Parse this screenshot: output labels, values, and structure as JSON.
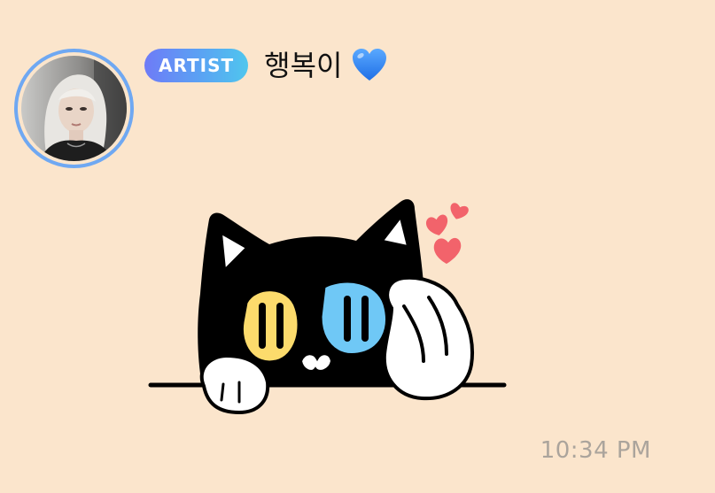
{
  "message": {
    "role_badge": "ARTIST",
    "sender_name": "행복이",
    "name_emoji_icon": "blue-heart-icon",
    "sticker_icon": "black-cat-peeking-sticker",
    "timestamp": "10:34 PM"
  },
  "colors": {
    "background": "#FBE5CC",
    "avatar_ring": "#6FA8F2",
    "badge_gradient_start": "#6E7BF7",
    "badge_gradient_end": "#4FC6EE",
    "timestamp_text": "#ABA49C",
    "heart_emoji": "#2F86F6",
    "sticker_hearts": "#F2636B"
  }
}
